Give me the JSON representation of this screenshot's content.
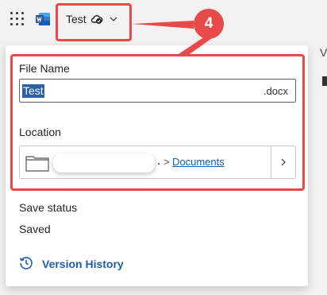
{
  "header": {
    "doc_title": "Test",
    "app_icon": "word-icon",
    "sync_icon": "cloud-sync-icon",
    "callout_number": "4",
    "right_edge_letter": "V"
  },
  "flyout": {
    "file_name_label": "File Name",
    "file_name_value": "Test",
    "file_extension": ".docx",
    "location_label": "Location",
    "location_separator": ">",
    "location_folder": "Documents",
    "save_status_label": "Save status",
    "save_status_value": "Saved",
    "version_history_label": "Version History"
  },
  "colors": {
    "annotation_red": "#e84a4a",
    "word_blue": "#2b579a",
    "link_blue": "#0f5ea8",
    "selection_blue": "#2b5fa6"
  }
}
